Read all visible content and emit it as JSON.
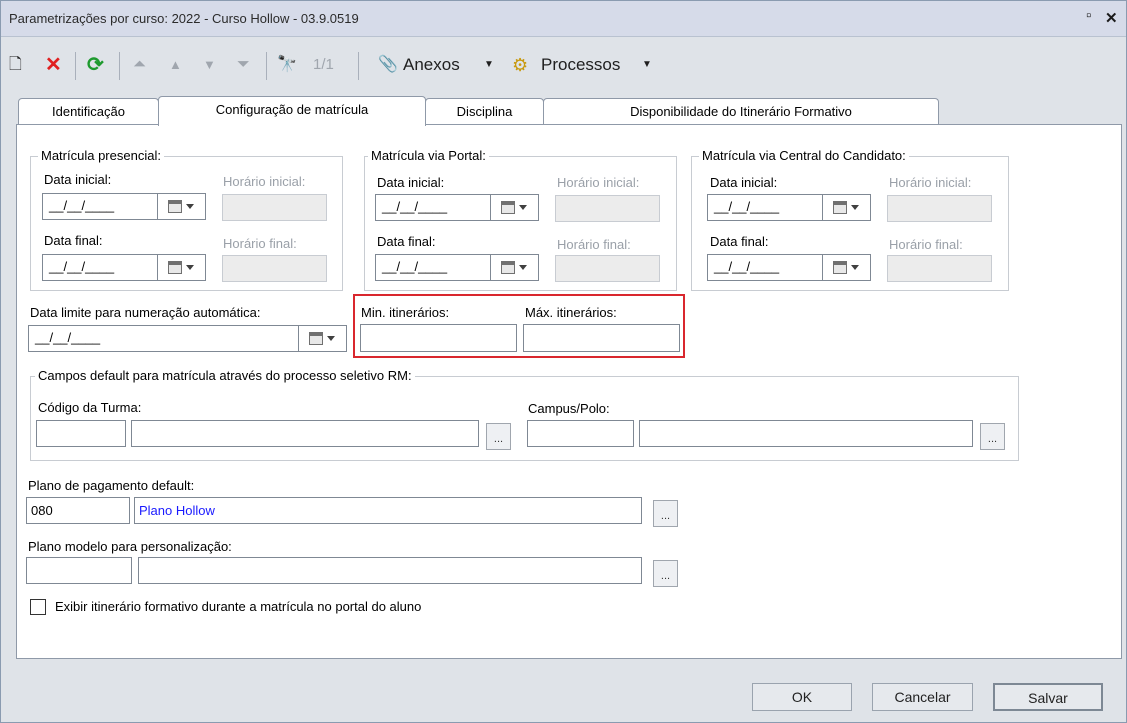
{
  "window": {
    "title": "Parametrizações por curso: 2022 - Curso Hollow - 03.9.0519",
    "restore_glyph": "▫",
    "close_glyph": "✕"
  },
  "toolbar": {
    "new_glyph": "🗋",
    "delete_glyph": "✕",
    "refresh_glyph": "⟳",
    "first_glyph": "⏶",
    "prev_glyph": "▲",
    "next_glyph": "▼",
    "last_glyph": "⏷",
    "find_glyph": "🔭",
    "record_counter": "1/1",
    "attach_glyph": "📎",
    "attachments_label": "Anexos",
    "dropdown_glyph": "▼",
    "process_glyph": "⚙",
    "processes_label": "Processos"
  },
  "tabs": [
    {
      "label": "Identificação"
    },
    {
      "label": "Configuração de matrícula"
    },
    {
      "label": "Disciplina"
    },
    {
      "label": "Disponibilidade do Itinerário Formativo"
    }
  ],
  "groups": [
    {
      "title": "Matrícula presencial:",
      "start_label": "Data inicial:",
      "start_value": "__/__/____",
      "start_time_label": "Horário inicial:",
      "end_label": "Data final:",
      "end_value": "__/__/____",
      "end_time_label": "Horário final:"
    },
    {
      "title": "Matrícula via Portal:",
      "start_label": "Data inicial:",
      "start_value": "__/__/____",
      "start_time_label": "Horário inicial:",
      "end_label": "Data final:",
      "end_value": "__/__/____",
      "end_time_label": "Horário final:"
    },
    {
      "title": "Matrícula via Central do Candidato:",
      "start_label": "Data inicial:",
      "start_value": "__/__/____",
      "start_time_label": "Horário inicial:",
      "end_label": "Data final:",
      "end_value": "__/__/____",
      "end_time_label": "Horário final:"
    }
  ],
  "limit": {
    "label": "Data limite para numeração automática:",
    "value": "__/__/____"
  },
  "itinerarios": {
    "min_label": "Min. itinerários:",
    "max_label": "Máx. itinerários:",
    "min_value": "",
    "max_value": ""
  },
  "defaults_group": {
    "title": "Campos default para matrícula através do processo seletivo RM:",
    "turma_label": "Código da Turma:",
    "campus_label": "Campus/Polo:",
    "lookup_glyph": "..."
  },
  "plano_pagamento": {
    "label": "Plano de pagamento default:",
    "code": "080",
    "name": "Plano Hollow",
    "name_color": "#1a1aff"
  },
  "plano_modelo": {
    "label": "Plano modelo para personalização:",
    "code": "",
    "name": ""
  },
  "checkbox_label": "Exibir itinerário formativo durante a matrícula no portal do aluno",
  "buttons": {
    "ok": "OK",
    "cancel": "Cancelar",
    "save": "Salvar"
  },
  "colors": {
    "highlight": "#d9272e",
    "delete_red": "#e02020",
    "refresh_green": "#1e9a2e",
    "link_blue": "#1a1aff"
  }
}
